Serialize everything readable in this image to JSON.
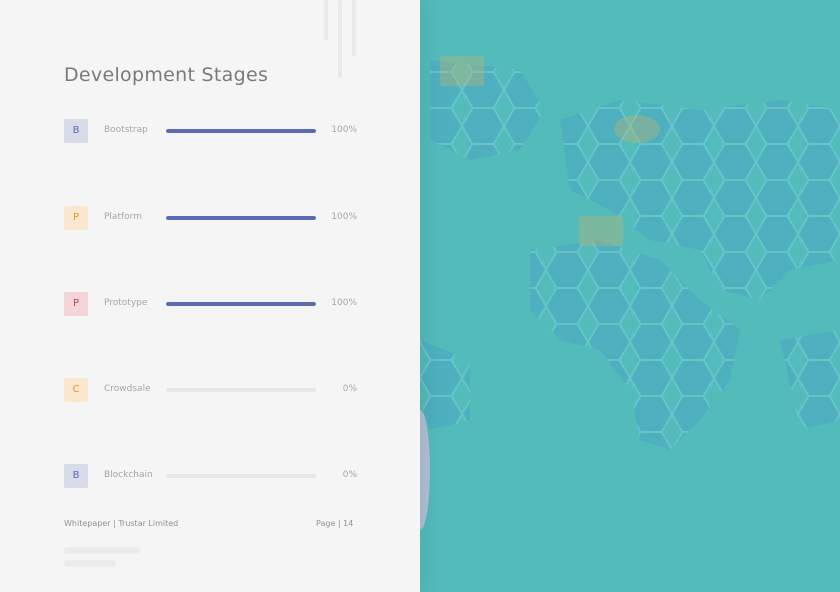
{
  "page": {
    "title": "Development Stages",
    "footer_left": "Whitepaper  |  Trustar Limited",
    "footer_right": "Page  |  14"
  },
  "stages": [
    {
      "initial": "B",
      "label": "Bootstrap",
      "progress": 100,
      "percent_text": "100%",
      "badge_bg": "#d8dbea",
      "badge_fg": "#5b6ab3"
    },
    {
      "initial": "P",
      "label": "Platform",
      "progress": 100,
      "percent_text": "100%",
      "badge_bg": "#fbe6cf",
      "badge_fg": "#e8972a"
    },
    {
      "initial": "P",
      "label": "Prototype",
      "progress": 100,
      "percent_text": "100%",
      "badge_bg": "#f4d6d8",
      "badge_fg": "#c0444c"
    },
    {
      "initial": "C",
      "label": "Crowdsale",
      "progress": 0,
      "percent_text": "0%",
      "badge_bg": "#fbe6cf",
      "badge_fg": "#e8972a"
    },
    {
      "initial": "B",
      "label": "Blockchain",
      "progress": 0,
      "percent_text": "0%",
      "badge_bg": "#d8dbea",
      "badge_fg": "#5b6ab3"
    }
  ],
  "colors": {
    "accent": "#5b6ab3",
    "map_background": "#53bbba",
    "page_background": "#f5f5f6"
  }
}
